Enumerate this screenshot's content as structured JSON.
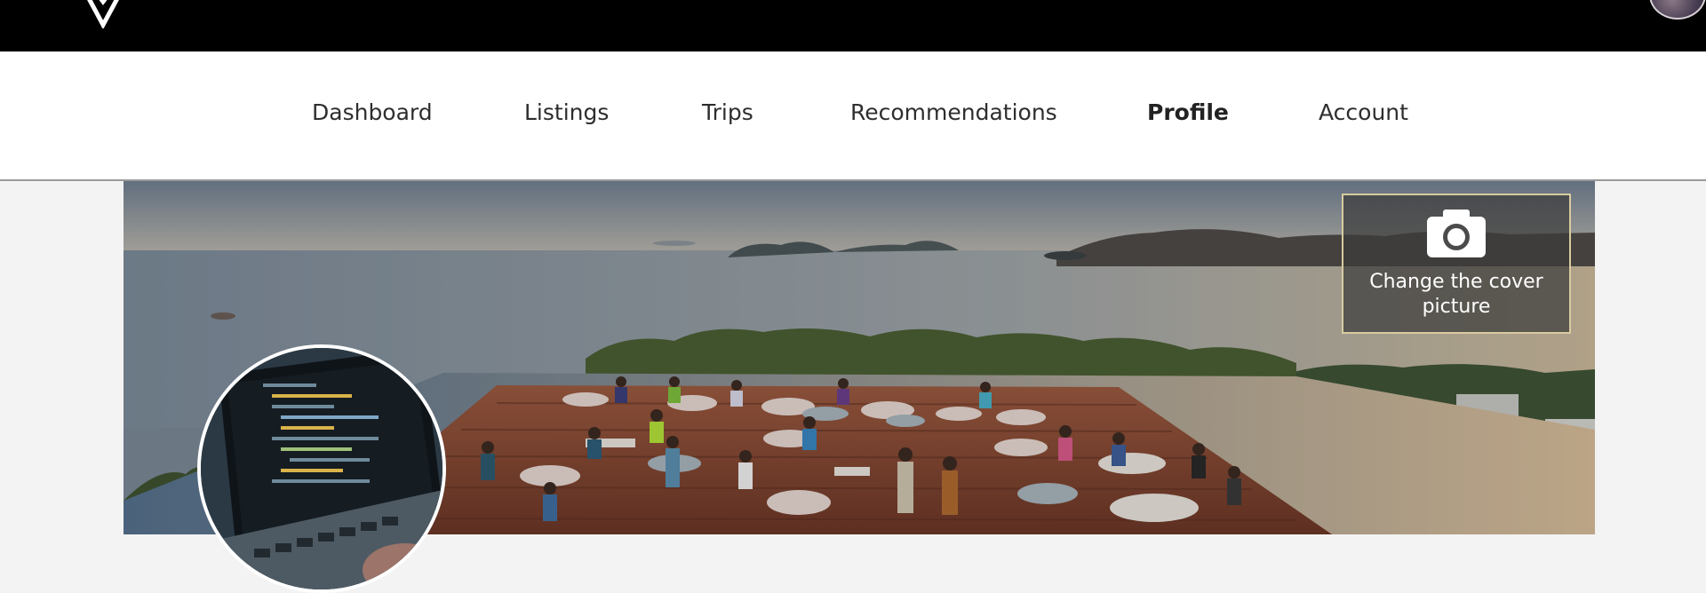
{
  "nav": {
    "items": [
      {
        "label": "Dashboard",
        "active": false
      },
      {
        "label": "Listings",
        "active": false
      },
      {
        "label": "Trips",
        "active": false
      },
      {
        "label": "Recommendations",
        "active": false
      },
      {
        "label": "Profile",
        "active": true
      },
      {
        "label": "Account",
        "active": false
      }
    ]
  },
  "cover": {
    "change_label": "Change the cover picture",
    "icon": "camera-icon"
  },
  "colors": {
    "topbar": "#000000",
    "nav_background": "#ffffff",
    "page_background": "#f3f3f3",
    "overlay_border": "#d8cba0"
  }
}
